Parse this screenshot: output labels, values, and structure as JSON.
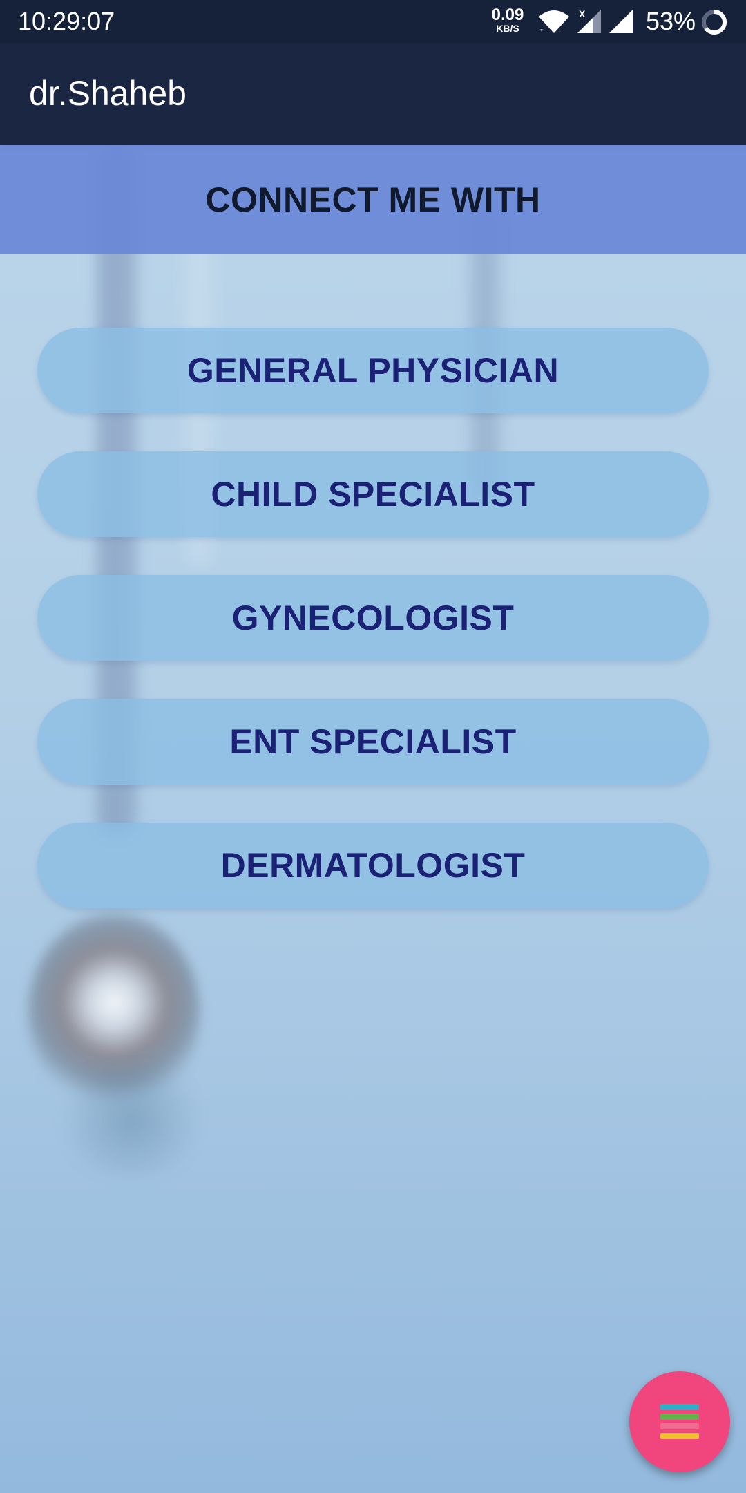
{
  "status_bar": {
    "time": "10:29:07",
    "net_speed_value": "0.09",
    "net_speed_unit": "KB/S",
    "signal_label": "X",
    "battery_percent": "53%",
    "icons": [
      "wifi-icon",
      "cell-signal-icon",
      "cell-signal-icon",
      "battery-charging-icon"
    ]
  },
  "app_bar": {
    "title": "dr.Shaheb"
  },
  "banner": {
    "title": "CONNECT ME WITH"
  },
  "specialists": [
    {
      "label": "GENERAL PHYSICIAN"
    },
    {
      "label": "CHILD SPECIALIST"
    },
    {
      "label": "GYNECOLOGIST"
    },
    {
      "label": "ENT SPECIALIST"
    },
    {
      "label": "DERMATOLOGIST"
    }
  ],
  "fab": {
    "icon": "menu-icon",
    "color": "#f0457d",
    "bar_colors": [
      "#2ab0c9",
      "#5fb548",
      "#f06c8e",
      "#f2c12e"
    ]
  },
  "colors": {
    "status_bar": "#16213a",
    "app_bar": "#1b2742",
    "banner": "#6887d6",
    "button_text": "#1b2175"
  }
}
